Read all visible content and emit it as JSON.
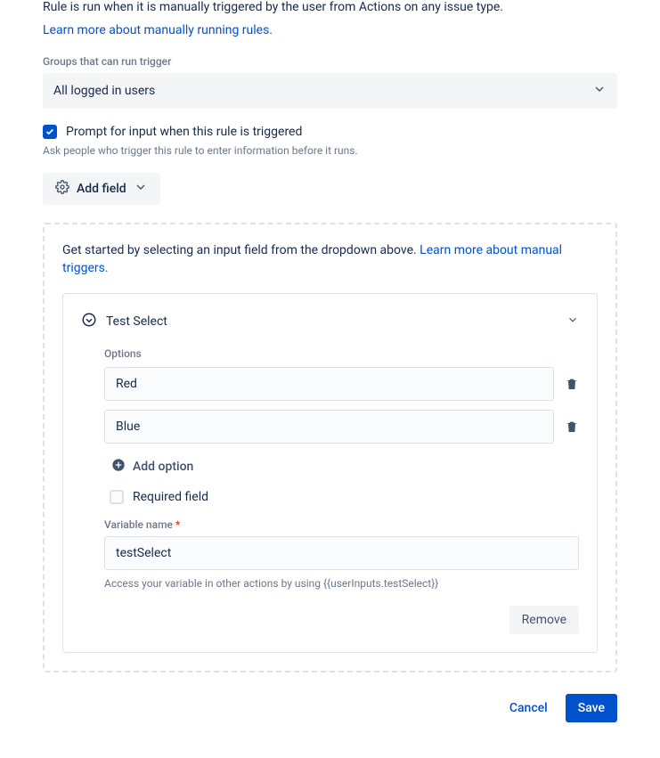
{
  "rule_description": "Rule is run when it is manually triggered by the user from Actions on any issue type.",
  "learn_more_rules": "Learn more about manually running rules.",
  "groups_label": "Groups that can run trigger",
  "groups_value": "All logged in users",
  "prompt_checkbox_label": "Prompt for input when this rule is triggered",
  "prompt_hint": "Ask people who trigger this rule to enter information before it runs.",
  "add_field_label": "Add field",
  "getting_started_text": "Get started by selecting an input field from the dropdown above. ",
  "getting_started_link": "Learn more about manual triggers.",
  "field": {
    "title": "Test Select",
    "options_label": "Options",
    "options": [
      "Red",
      "Blue"
    ],
    "add_option_label": "Add option",
    "required_label": "Required field",
    "variable_label": "Variable name",
    "variable_value": "testSelect",
    "variable_hint": "Access your variable in other actions by using {{userInputs.testSelect}}",
    "remove_label": "Remove"
  },
  "footer": {
    "cancel": "Cancel",
    "save": "Save"
  }
}
